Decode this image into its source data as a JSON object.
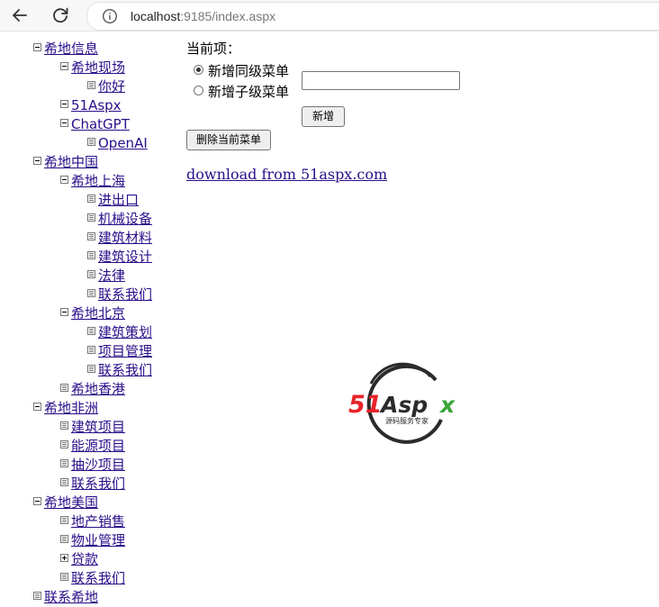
{
  "browser": {
    "url_host": "localhost",
    "url_rest": ":9185/index.aspx"
  },
  "tree": [
    {
      "label": "希地信息",
      "level": 0,
      "icon": "minus"
    },
    {
      "label": "希地现场",
      "level": 1,
      "icon": "minus"
    },
    {
      "label": "你好",
      "level": 2,
      "icon": "leaf"
    },
    {
      "label": "51Aspx",
      "level": 1,
      "icon": "minus"
    },
    {
      "label": "ChatGPT",
      "level": 1,
      "icon": "minus"
    },
    {
      "label": "OpenAI",
      "level": 2,
      "icon": "leaf"
    },
    {
      "label": "希地中国",
      "level": 0,
      "icon": "minus"
    },
    {
      "label": "希地上海",
      "level": 1,
      "icon": "minus"
    },
    {
      "label": "进出口",
      "level": 2,
      "icon": "leaf"
    },
    {
      "label": "机械设备",
      "level": 2,
      "icon": "leaf"
    },
    {
      "label": "建筑材料",
      "level": 2,
      "icon": "leaf"
    },
    {
      "label": "建筑设计",
      "level": 2,
      "icon": "leaf"
    },
    {
      "label": "法律",
      "level": 2,
      "icon": "leaf"
    },
    {
      "label": "联系我们",
      "level": 2,
      "icon": "leaf"
    },
    {
      "label": "希地北京",
      "level": 1,
      "icon": "minus"
    },
    {
      "label": "建筑策划",
      "level": 2,
      "icon": "leaf"
    },
    {
      "label": "项目管理",
      "level": 2,
      "icon": "leaf"
    },
    {
      "label": "联系我们",
      "level": 2,
      "icon": "leaf"
    },
    {
      "label": "希地香港",
      "level": 1,
      "icon": "leaf"
    },
    {
      "label": "希地非洲",
      "level": 0,
      "icon": "minus"
    },
    {
      "label": "建筑项目",
      "level": 1,
      "icon": "leaf"
    },
    {
      "label": "能源项目",
      "level": 1,
      "icon": "leaf"
    },
    {
      "label": "抽沙项目",
      "level": 1,
      "icon": "leaf"
    },
    {
      "label": "联系我们",
      "level": 1,
      "icon": "leaf"
    },
    {
      "label": "希地美国",
      "level": 0,
      "icon": "minus"
    },
    {
      "label": "地产销售",
      "level": 1,
      "icon": "leaf"
    },
    {
      "label": "物业管理",
      "level": 1,
      "icon": "leaf"
    },
    {
      "label": "贷款",
      "level": 1,
      "icon": "plus"
    },
    {
      "label": "联系我们",
      "level": 1,
      "icon": "leaf"
    },
    {
      "label": "联系希地",
      "level": 0,
      "icon": "leaf"
    }
  ],
  "panel": {
    "current_label": "当前项：",
    "radio_sibling": "新增同级菜单",
    "radio_child": "新增子级菜单",
    "radio_selected": "sibling",
    "name_value": "",
    "add_button": "新增",
    "delete_button": "删除当前菜单",
    "download_link": "download from 51aspx.com"
  },
  "logo": {
    "brand_text": "51Aspx",
    "tagline": "源码服务专家",
    "colors": {
      "red": "#e8232a",
      "green": "#3aa537",
      "dark": "#2b2b2b"
    }
  }
}
